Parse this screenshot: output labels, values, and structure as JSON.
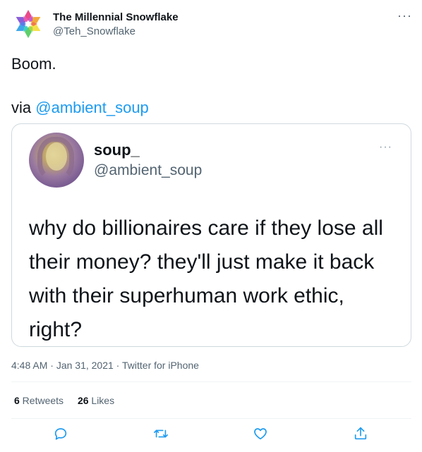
{
  "author": {
    "name": "The Millennial Snowflake",
    "handle": "@Teh_Snowflake"
  },
  "tweet": {
    "line1": "Boom.",
    "via_prefix": "via ",
    "via_mention": "@ambient_soup"
  },
  "quote": {
    "name": "soup_",
    "handle": "@ambient_soup",
    "body": "why do billionaires care if they lose all their money? they'll just make it back with their superhuman work ethic, right?"
  },
  "meta": {
    "time": "4:48 AM",
    "sep1": " · ",
    "date": "Jan 31, 2021",
    "sep2": " · ",
    "source": "Twitter for iPhone"
  },
  "stats": {
    "retweets_count": "6",
    "retweets_label": " Retweets",
    "likes_count": "26",
    "likes_label": " Likes"
  },
  "icons": {
    "avatar": "snowflake-icon",
    "more": "more-icon",
    "reply": "reply-icon",
    "retweet": "retweet-icon",
    "like": "heart-icon",
    "share": "share-icon"
  },
  "colors": {
    "accent": "#1d9bf0",
    "secondary_text": "#536471",
    "border": "#cfd9de"
  }
}
